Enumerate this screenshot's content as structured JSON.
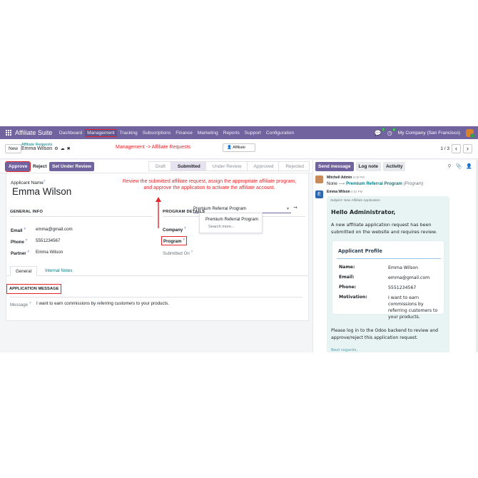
{
  "navbar": {
    "app_name": "Affiliate Suite",
    "menus": [
      "Dashboard",
      "Management",
      "Tracking",
      "Subscriptions",
      "Finance",
      "Marketing",
      "Reports",
      "Support",
      "Configuration"
    ],
    "highlighted_menu": "Management",
    "chat_badge": "7",
    "activity_badge": "4",
    "company": "My Company (San Francisco)"
  },
  "control_panel": {
    "new_label": "New",
    "breadcrumb_parent": "Affiliate Requests",
    "breadcrumb_current": "Emma Wilson",
    "annotation": "Management -> Affiliate Requests",
    "smart_button": "Affiliate",
    "pager": "1 / 3"
  },
  "toolbar": {
    "approve": "Approve",
    "reject": "Reject",
    "set_under_review": "Set Under Review",
    "annotation_line1": "Review the submitted affiliate request, assign the appropriate affiliate program,",
    "annotation_line2": "and approve the application to activate the affiliate account."
  },
  "statusbar": {
    "stages": [
      "Draft",
      "Submitted",
      "Under Review",
      "Approved",
      "Rejected"
    ],
    "active": "Submitted"
  },
  "form": {
    "applicant_name_label": "Applicant Name",
    "applicant_name": "Emma Wilson",
    "general_info": "GENERAL INFO",
    "program_details": "PROGRAM DETAILS",
    "email_label": "Email",
    "email": "emma@gmail.com",
    "phone_label": "Phone",
    "phone": "5551234567",
    "partner_label": "Partner",
    "partner": "Emma Wilson",
    "company_label": "Company",
    "program_label": "Program",
    "program": "Premium Referral Program",
    "submitted_on_label": "Submitted On",
    "dropdown_option": "Premium Referral Program",
    "dropdown_more": "Search more...",
    "tabs": [
      "General",
      "Internal Notes"
    ],
    "application_message": "APPLICATION MESSAGE",
    "message_label": "Message",
    "message": "I want to earn commissions by referring customers to your products."
  },
  "chatter": {
    "send_message": "Send message",
    "log_note": "Log note",
    "activity": "Activity",
    "msg1_author": "Mitchell Admin",
    "msg1_time": "6:05 PM",
    "tracking_old": "None",
    "tracking_new": "Premium Referral Program",
    "tracking_field": "(Program)",
    "msg2_author": "Emma Wilson",
    "msg2_time": "6:02 PM",
    "avatar_letter": "E",
    "subject": "Subject: New Affiliate Application",
    "greeting": "Hello Administrator,",
    "intro": "A new affiliate application request has been submitted on the website and requires review.",
    "profile_title": "Applicant Profile",
    "profile": [
      {
        "k": "Name:",
        "v": "Emma Wilson"
      },
      {
        "k": "Email:",
        "v": "emma@gmail.com"
      },
      {
        "k": "Phone:",
        "v": "5551234567"
      },
      {
        "k": "Motivation:",
        "v": "I want to earn commissions by referring customers to your products."
      }
    ],
    "footer": "Please log in to the Odoo backend to review and approve/reject this application request.",
    "regards": "Best regards,"
  },
  "colors": {
    "brand": "#71639e",
    "annotation": "#e4262c",
    "link": "#017e84"
  }
}
